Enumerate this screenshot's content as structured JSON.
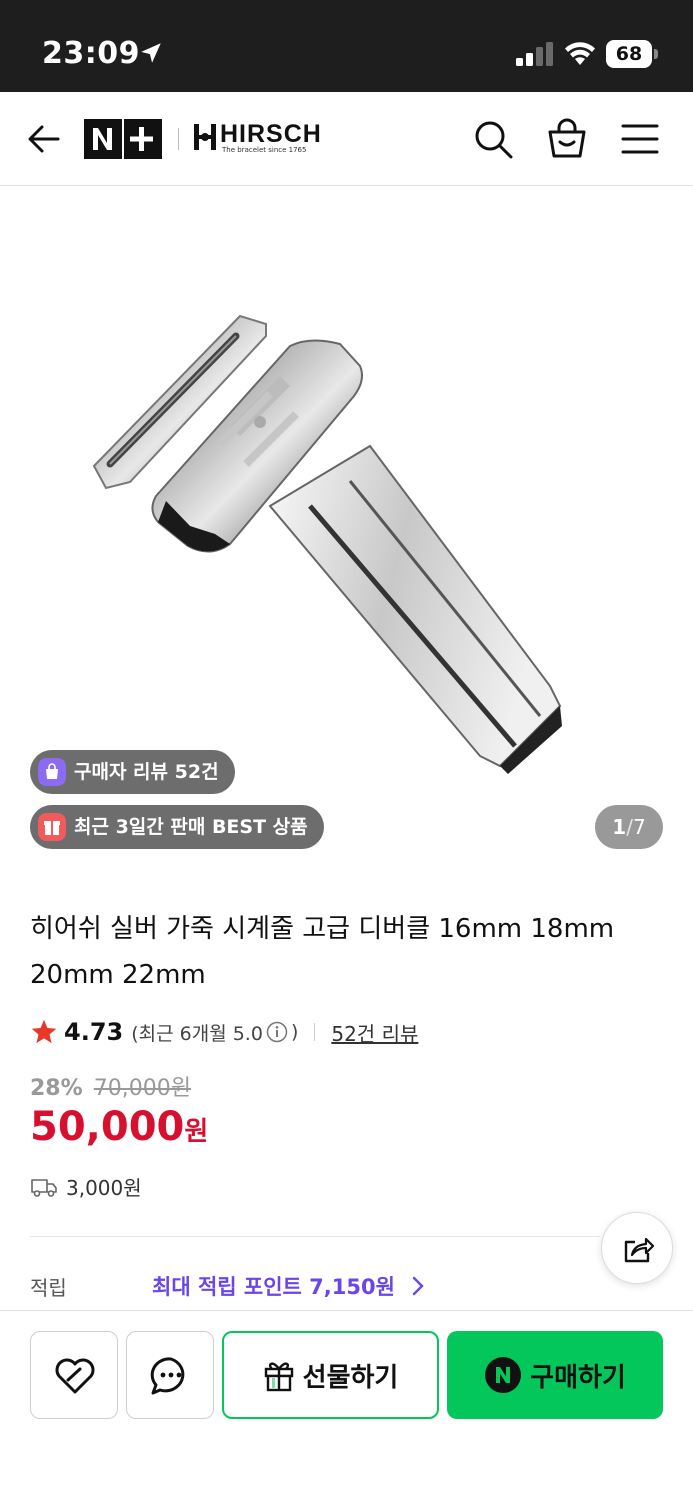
{
  "status_bar": {
    "time": "23:09",
    "battery": "68"
  },
  "header": {
    "store_logo_text": "N+",
    "brand_name": "HIRSCH",
    "brand_tagline": "The bracelet since 1765",
    "icons": [
      "arrow-left-icon",
      "search-icon",
      "shopping-bag-icon",
      "hamburger-menu-icon"
    ]
  },
  "gallery": {
    "badge_review": "구매자 리뷰 52건",
    "badge_best": "최근 3일간 판매 BEST 상품",
    "page_current": "1",
    "page_separator": "/",
    "page_total": "7"
  },
  "product": {
    "title": "히어쉬 실버 가죽 시계줄 고급 디버클 16mm 18mm 20mm 22mm",
    "rating": "4.73",
    "rating_recent_open": "(최근 6개월 5.0",
    "rating_recent_close": ")",
    "review_link": "52건 리뷰",
    "discount_rate": "28%",
    "original_price": "70,000원",
    "price": "50,000",
    "price_unit": "원",
    "shipping_fee": "3,000원",
    "points_label": "적립",
    "points_value": "최대 적립 포인트 7,150원"
  },
  "bottom_bar": {
    "gift_label": "선물하기",
    "buy_label": "구매하기"
  },
  "colors": {
    "price_red": "#d8102f",
    "naver_green": "#03c75a",
    "points_purple": "#6b45e8",
    "star_red": "#e8382a"
  }
}
